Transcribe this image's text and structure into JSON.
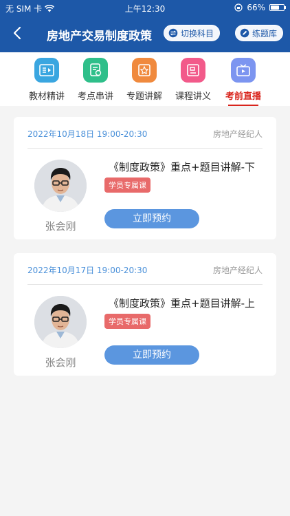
{
  "status": {
    "carrier": "无 SIM 卡",
    "time": "上午12:30",
    "battery": "66%",
    "battery_level": 0.66
  },
  "header": {
    "title": "房地产交易制度政策",
    "switch_label": "切换科目",
    "practice_label": "练题库"
  },
  "tabs": [
    {
      "label": "教材精讲",
      "color": "#3aa6e0",
      "icon": "book-icon",
      "active": false
    },
    {
      "label": "考点串讲",
      "color": "#2fbf8a",
      "icon": "notes-icon",
      "active": false
    },
    {
      "label": "专题讲解",
      "color": "#f08a3e",
      "icon": "topic-icon",
      "active": false
    },
    {
      "label": "课程讲义",
      "color": "#f25a8a",
      "icon": "handout-icon",
      "active": false
    },
    {
      "label": "考前直播",
      "color": "#7c95f0",
      "icon": "tv-icon",
      "active": true
    }
  ],
  "cards": [
    {
      "date": "2022年10月18日 19:00-20:30",
      "category": "房地产经纪人",
      "course": "《制度政策》重点+题目讲解-下",
      "badge": "学员专属课",
      "teacher": "张会刚",
      "button": "立即预约"
    },
    {
      "date": "2022年10月17日 19:00-20:30",
      "category": "房地产经纪人",
      "course": "《制度政策》重点+题目讲解-上",
      "badge": "学员专属课",
      "teacher": "张会刚",
      "button": "立即预约"
    }
  ],
  "colors": {
    "header_bg": "#1d58a8",
    "active_tab": "#d9241c",
    "button": "#5b96df",
    "badge": "#e86a6a"
  }
}
